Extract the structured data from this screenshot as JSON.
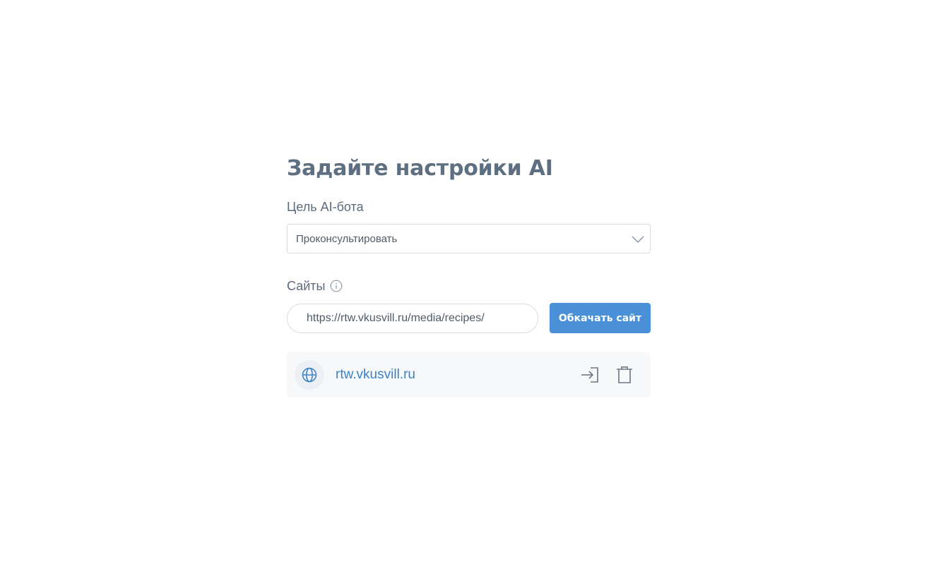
{
  "page": {
    "title": "Задайте настройки AI"
  },
  "goal": {
    "label": "Цель AI-бота",
    "selected": "Проконсультировать"
  },
  "sites": {
    "label": "Сайты",
    "url_value": "https://rtw.vkusvill.ru/media/recipes/",
    "crawl_button": "Обкачать сайт",
    "items": [
      {
        "name": "rtw.vkusvill.ru"
      }
    ]
  },
  "icons": {
    "select": "chevron-down-icon",
    "info": "info-icon",
    "site": "globe-icon",
    "open": "sign-in-icon",
    "delete": "trash-icon"
  },
  "colors": {
    "title": "#5f6f82",
    "accent": "#4a90d9",
    "link": "#3b82c4",
    "card_bg": "#f6f8fa"
  }
}
